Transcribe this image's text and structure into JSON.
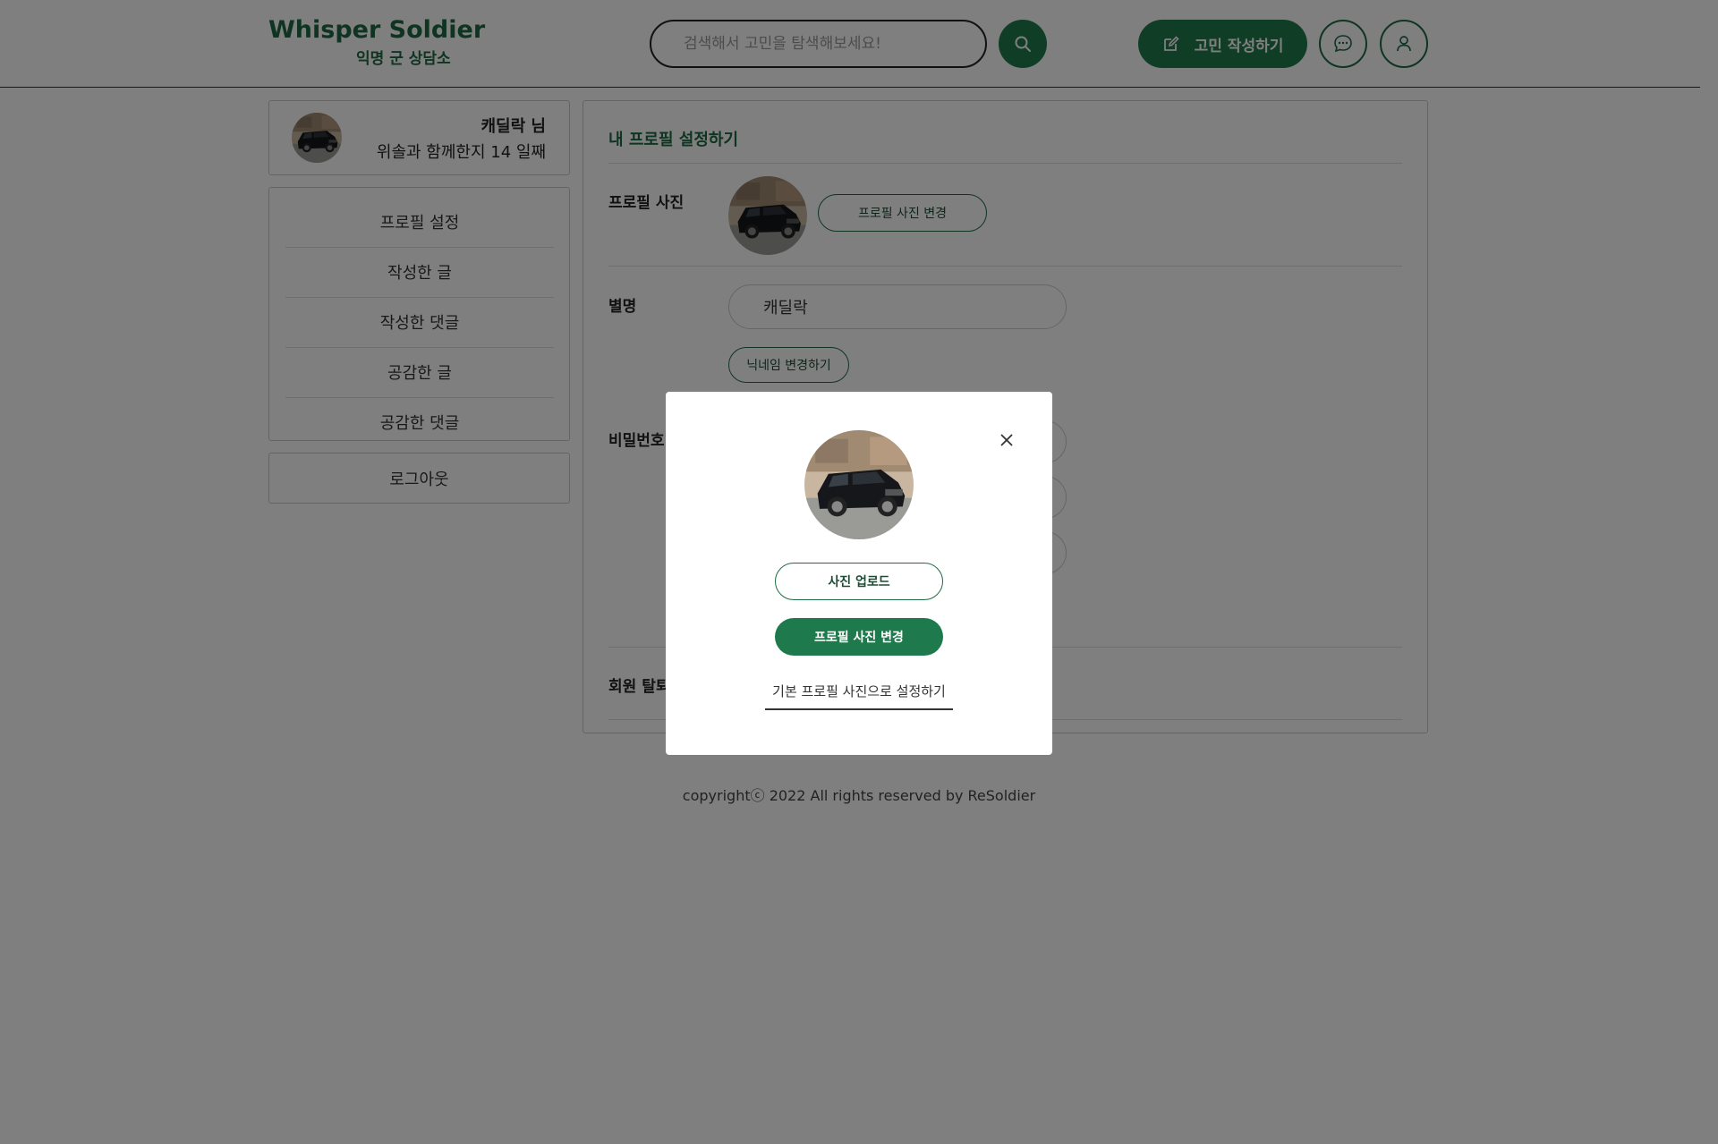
{
  "header": {
    "logo_title": "Whisper Soldier",
    "logo_subtitle": "익명 군 상담소",
    "search_placeholder": "검색해서 고민을 탐색해보세요!",
    "write_label": "고민 작성하기",
    "icons": {
      "search": "search-icon",
      "write": "pencil-square-icon",
      "chat": "chat-bubble-icon",
      "user": "user-icon"
    }
  },
  "sidebar": {
    "profile_name": "캐딜락 님",
    "profile_days": "위솔과 함께한지 14 일째",
    "menu": [
      {
        "label": "프로필 설정"
      },
      {
        "label": "작성한 글"
      },
      {
        "label": "작성한 댓글"
      },
      {
        "label": "공감한 글"
      },
      {
        "label": "공감한 댓글"
      }
    ],
    "logout_label": "로그아웃"
  },
  "main": {
    "title": "내 프로필 설정하기",
    "photo_label": "프로필 사진",
    "change_photo_label": "프로필 사진 변경",
    "nickname_label": "별명",
    "nickname_value": "캐딜락",
    "nickname_button": "닉네임 변경하기",
    "password_label": "비밀번호",
    "withdraw_label": "회원 탈퇴"
  },
  "footer": {
    "text": "copyrightⓒ 2022 All rights reserved by ReSoldier"
  },
  "modal": {
    "upload_label": "사진 업로드",
    "apply_label": "프로필 사진 변경",
    "default_label": "기본 프로필 사진으로 설정하기",
    "close_icon": "close-icon"
  },
  "colors": {
    "brand_green": "#1e7a4c",
    "brand_text_green": "#1e6b45",
    "overlay": "rgba(0,0,0,0.5)"
  }
}
